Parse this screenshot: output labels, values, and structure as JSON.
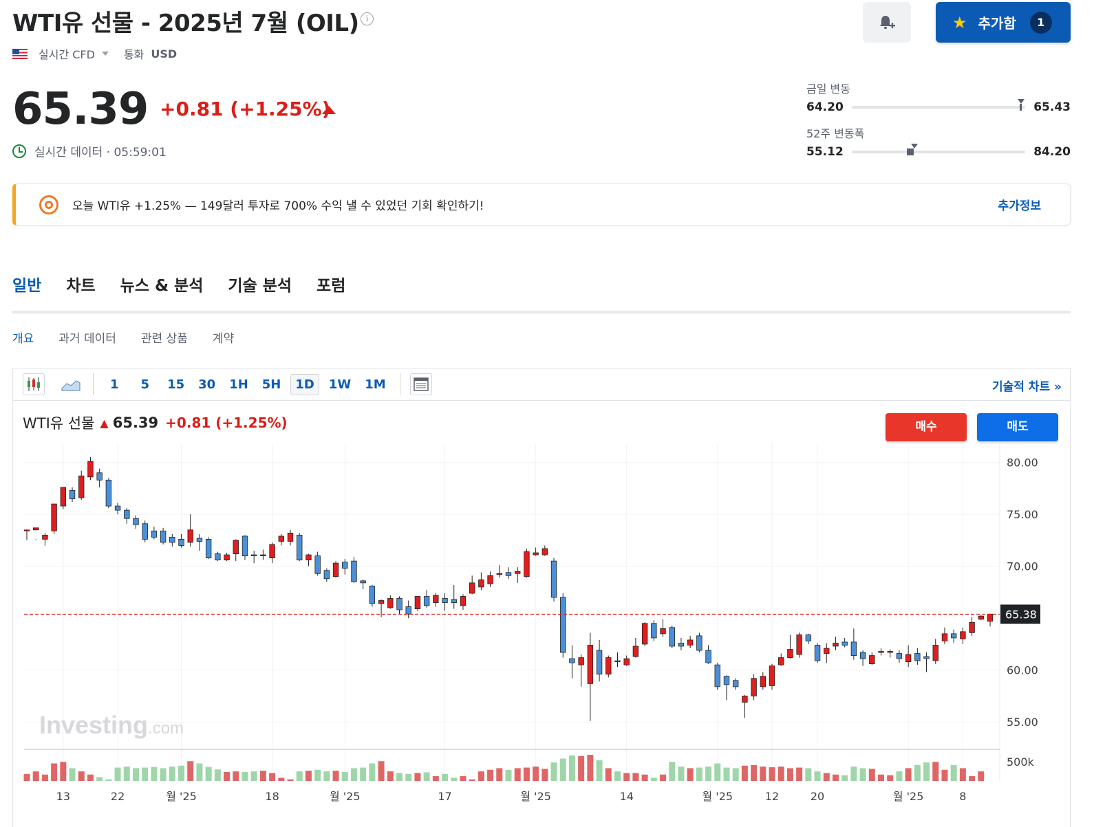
{
  "header": {
    "title": "WTI유 선물 - 2025년 7월 (OIL)",
    "info_icon": "info-icon",
    "market_type": "실시간 CFD",
    "currency_label": "통화",
    "currency": "USD",
    "watchlist_label": "추가함",
    "watchlist_count": "1"
  },
  "quote": {
    "price": "65.39",
    "change": "+0.81 (+1.25%)",
    "realtime_text": "실시간 데이터 · 05:59:01"
  },
  "ranges": {
    "day_label": "금일 변동",
    "day_low": "64.20",
    "day_high": "65.43",
    "week52_label": "52주 변동폭",
    "week52_low": "55.12",
    "week52_high": "84.20"
  },
  "promo": {
    "text": "오늘 WTI유 +1.25% — 149달러 투자로 700% 수익 낼 수 있었던 기회 확인하기!",
    "more": "추가정보"
  },
  "tabs": [
    "일반",
    "차트",
    "뉴스 & 분석",
    "기술 분석",
    "포럼"
  ],
  "subtabs": [
    "개요",
    "과거 데이터",
    "관련 상품",
    "계약"
  ],
  "toolbar": {
    "timeframes": [
      "1",
      "5",
      "15",
      "30",
      "1H",
      "5H",
      "1D",
      "1W",
      "1M"
    ],
    "active_timeframe": "1D",
    "tech_chart_link": "기술적 차트 »"
  },
  "chart_head": {
    "name": "WTI유 선물",
    "price": "65.39",
    "change": "+0.81 (+1.25%)",
    "buy": "매수",
    "sell": "매도",
    "watermark_main": "Investing",
    "watermark_suffix": ".com"
  },
  "colors": {
    "up": "#e01e1e",
    "down": "#4a90d9",
    "vol_up": "#e06666",
    "vol_down": "#9fd6a9",
    "accent": "#0b5bb5"
  },
  "chart_data": {
    "type": "candlestick",
    "y_ticks": [
      "80.00",
      "75.00",
      "70.00",
      "60.00",
      "55.00"
    ],
    "y_range": [
      52.5,
      81.5
    ],
    "volume_tick": "500k",
    "last_price_label": "65.38",
    "last_price": 65.38,
    "x_ticks": [
      "13",
      "22",
      "월 '25",
      "18",
      "월 '25",
      "17",
      "월 '25",
      "14",
      "월 '25",
      "12",
      "20",
      "월 '25",
      "8"
    ],
    "x_tick_index": [
      4,
      10,
      17,
      27,
      35,
      46,
      56,
      66,
      76,
      82,
      87,
      97,
      103
    ],
    "candles": [
      [
        73.5,
        73.5,
        72.5,
        73.5
      ],
      [
        73.5,
        73.7,
        72.5,
        72.6
      ],
      [
        72.6,
        73.0,
        72.0,
        73.2
      ],
      [
        73.4,
        76.0,
        73.1,
        75.8
      ],
      [
        75.8,
        77.6,
        75.5,
        77.4
      ],
      [
        77.3,
        76.5,
        76.2,
        77.6
      ],
      [
        76.6,
        78.7,
        76.4,
        79.2
      ],
      [
        78.6,
        80.1,
        78.3,
        80.5
      ],
      [
        79.0,
        78.3,
        77.6,
        79.4
      ],
      [
        78.3,
        75.8,
        75.6,
        78.5
      ],
      [
        75.8,
        75.4,
        75.0,
        76.1
      ],
      [
        75.4,
        74.6,
        74.1,
        75.6
      ],
      [
        74.6,
        74.0,
        73.6,
        74.9
      ],
      [
        74.1,
        72.6,
        72.3,
        74.4
      ],
      [
        73.4,
        72.8,
        72.6,
        73.8
      ],
      [
        73.4,
        72.3,
        72.1,
        73.7
      ],
      [
        72.8,
        72.3,
        71.9,
        73.1
      ],
      [
        72.6,
        72.0,
        71.8,
        73.1
      ],
      [
        72.3,
        73.5,
        71.9,
        75.0
      ],
      [
        72.7,
        72.4,
        71.5,
        73.1
      ],
      [
        72.6,
        70.8,
        70.7,
        72.8
      ],
      [
        71.2,
        70.6,
        70.5,
        71.4
      ],
      [
        70.6,
        71.1,
        70.5,
        71.3
      ],
      [
        71.2,
        72.5,
        70.5,
        72.6
      ],
      [
        72.9,
        71.0,
        70.6,
        73.0
      ],
      [
        71.1,
        71.0,
        70.3,
        71.5
      ],
      [
        71.0,
        71.1,
        70.6,
        71.6
      ],
      [
        70.8,
        72.1,
        70.3,
        72.3
      ],
      [
        72.4,
        72.9,
        72.0,
        73.1
      ],
      [
        72.4,
        73.2,
        72.0,
        73.5
      ],
      [
        73.0,
        70.6,
        70.5,
        73.2
      ],
      [
        70.6,
        71.1,
        70.0,
        71.2
      ],
      [
        71.0,
        69.3,
        69.1,
        71.4
      ],
      [
        69.6,
        68.8,
        68.5,
        69.8
      ],
      [
        69.0,
        70.3,
        68.9,
        70.5
      ],
      [
        70.4,
        69.8,
        69.2,
        70.7
      ],
      [
        70.5,
        68.5,
        68.4,
        70.9
      ],
      [
        68.6,
        68.4,
        67.8,
        68.7
      ],
      [
        68.1,
        66.4,
        66.1,
        68.2
      ],
      [
        66.4,
        66.7,
        65.1,
        66.8
      ],
      [
        66.0,
        66.9,
        65.9,
        67.2
      ],
      [
        66.9,
        65.8,
        65.4,
        67.1
      ],
      [
        66.1,
        65.4,
        65.0,
        66.7
      ],
      [
        65.9,
        67.1,
        65.7,
        67.1
      ],
      [
        67.1,
        66.2,
        66.0,
        67.7
      ],
      [
        66.5,
        67.2,
        66.1,
        67.4
      ],
      [
        66.9,
        66.5,
        65.7,
        67.4
      ],
      [
        66.8,
        66.5,
        65.9,
        68.2
      ],
      [
        66.2,
        67.1,
        65.8,
        67.3
      ],
      [
        67.4,
        68.4,
        67.3,
        69.1
      ],
      [
        68.0,
        68.7,
        67.7,
        69.4
      ],
      [
        68.3,
        69.1,
        68.0,
        69.5
      ],
      [
        69.2,
        69.3,
        68.9,
        70.1
      ],
      [
        69.4,
        69.1,
        68.8,
        69.9
      ],
      [
        69.3,
        69.5,
        68.4,
        69.9
      ],
      [
        69.0,
        71.4,
        68.9,
        71.7
      ],
      [
        71.1,
        71.3,
        71.0,
        71.8
      ],
      [
        71.1,
        71.7,
        71.0,
        72.0
      ],
      [
        70.5,
        67.0,
        66.6,
        70.8
      ],
      [
        67.0,
        61.7,
        61.2,
        67.4
      ],
      [
        61.1,
        60.7,
        59.2,
        62.4
      ],
      [
        60.5,
        61.2,
        58.4,
        61.5
      ],
      [
        58.7,
        62.4,
        55.1,
        63.6
      ],
      [
        61.9,
        59.6,
        58.9,
        62.9
      ],
      [
        59.6,
        61.2,
        59.3,
        61.4
      ],
      [
        60.9,
        60.8,
        60.3,
        61.7
      ],
      [
        60.5,
        61.1,
        60.4,
        61.4
      ],
      [
        61.3,
        62.3,
        61.2,
        63.1
      ],
      [
        62.5,
        64.5,
        62.3,
        64.6
      ],
      [
        64.5,
        63.1,
        62.8,
        64.8
      ],
      [
        63.5,
        64.0,
        63.2,
        64.9
      ],
      [
        64.1,
        62.3,
        62.1,
        64.3
      ],
      [
        62.6,
        62.3,
        61.9,
        63.1
      ],
      [
        62.4,
        62.9,
        62.1,
        63.3
      ],
      [
        63.3,
        61.9,
        61.7,
        63.6
      ],
      [
        61.9,
        60.7,
        60.6,
        62.4
      ],
      [
        60.5,
        58.4,
        58.1,
        60.7
      ],
      [
        59.4,
        58.6,
        57.1,
        59.5
      ],
      [
        59.0,
        58.4,
        58.1,
        59.2
      ],
      [
        56.9,
        57.5,
        55.4,
        57.6
      ],
      [
        57.5,
        59.2,
        57.1,
        59.6
      ],
      [
        58.4,
        59.4,
        58.1,
        59.8
      ],
      [
        58.5,
        60.4,
        58.1,
        60.6
      ],
      [
        60.5,
        61.2,
        60.4,
        61.6
      ],
      [
        61.2,
        62.0,
        61.1,
        63.4
      ],
      [
        61.5,
        63.4,
        61.2,
        63.6
      ],
      [
        63.4,
        62.8,
        62.5,
        63.5
      ],
      [
        62.4,
        60.9,
        60.7,
        62.6
      ],
      [
        61.6,
        62.1,
        60.7,
        62.6
      ],
      [
        62.3,
        62.6,
        61.9,
        63.2
      ],
      [
        62.7,
        62.4,
        62.2,
        63.1
      ],
      [
        62.7,
        61.4,
        61.0,
        64.0
      ],
      [
        61.7,
        61.1,
        60.4,
        61.9
      ],
      [
        60.6,
        61.4,
        60.5,
        61.7
      ],
      [
        61.7,
        61.8,
        61.4,
        62.1
      ],
      [
        61.8,
        61.8,
        61.2,
        62.0
      ],
      [
        61.6,
        61.1,
        60.7,
        61.9
      ],
      [
        60.8,
        61.5,
        60.3,
        62.4
      ],
      [
        61.6,
        60.9,
        60.5,
        62.1
      ],
      [
        61.3,
        61.1,
        59.8,
        61.7
      ],
      [
        60.9,
        62.4,
        60.6,
        63.0
      ],
      [
        62.8,
        63.5,
        62.5,
        64.1
      ],
      [
        63.5,
        63.1,
        62.6,
        63.9
      ],
      [
        63.0,
        63.7,
        62.5,
        64.1
      ],
      [
        63.6,
        64.6,
        63.3,
        65.1
      ],
      [
        64.9,
        65.2,
        64.8,
        65.3
      ],
      [
        64.7,
        65.39,
        64.2,
        65.43
      ]
    ],
    "volume": [
      0.22,
      0.3,
      0.2,
      0.55,
      0.6,
      0.4,
      0.3,
      0.2,
      0.12,
      0.05,
      0.42,
      0.45,
      0.4,
      0.42,
      0.44,
      0.4,
      0.45,
      0.48,
      0.62,
      0.55,
      0.44,
      0.36,
      0.28,
      0.3,
      0.28,
      0.3,
      0.32,
      0.25,
      0.1,
      0.05,
      0.3,
      0.32,
      0.35,
      0.3,
      0.32,
      0.28,
      0.4,
      0.42,
      0.55,
      0.62,
      0.3,
      0.25,
      0.22,
      0.25,
      0.27,
      0.15,
      0.22,
      0.1,
      0.15,
      0.05,
      0.3,
      0.35,
      0.4,
      0.35,
      0.4,
      0.42,
      0.45,
      0.38,
      0.58,
      0.7,
      0.8,
      0.78,
      0.82,
      0.65,
      0.4,
      0.3,
      0.25,
      0.25,
      0.2,
      0.1,
      0.2,
      0.6,
      0.45,
      0.4,
      0.42,
      0.45,
      0.55,
      0.42,
      0.4,
      0.48,
      0.5,
      0.45,
      0.43,
      0.45,
      0.4,
      0.42,
      0.4,
      0.3,
      0.25,
      0.2,
      0.18,
      0.45,
      0.4,
      0.38,
      0.2,
      0.18,
      0.3,
      0.4,
      0.5,
      0.58,
      0.6,
      0.35,
      0.5,
      0.4,
      0.15,
      0.3
    ]
  }
}
